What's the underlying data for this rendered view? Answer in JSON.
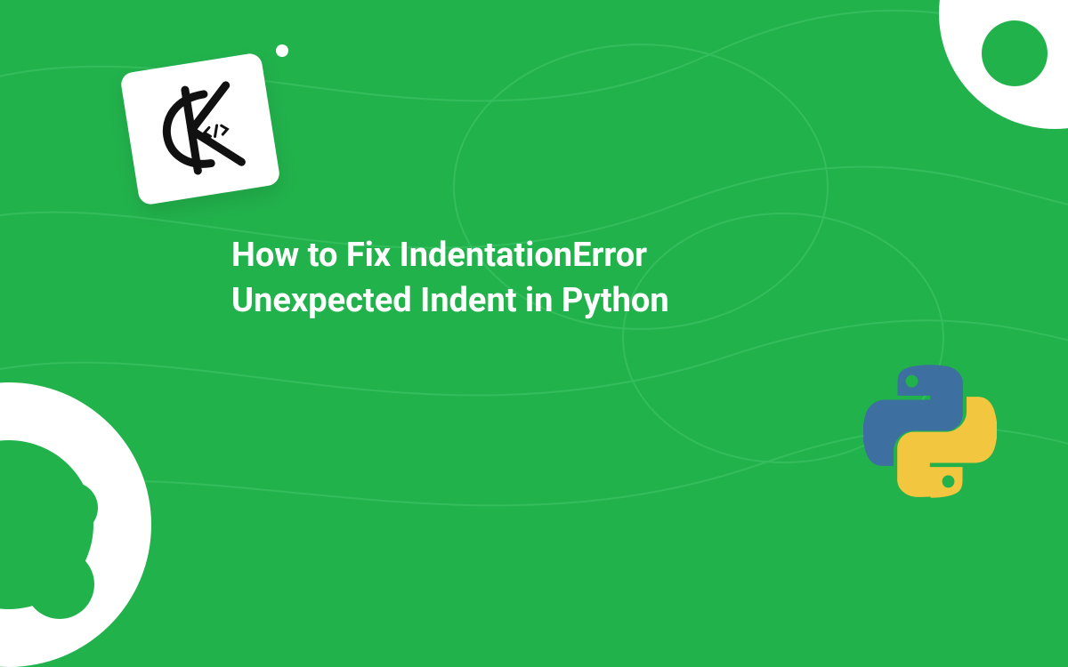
{
  "title_line1": "How to Fix IndentationError",
  "title_line2": "Unexpected Indent in Python",
  "colors": {
    "background": "#22b24c",
    "card": "#ffffff",
    "monogram": "#111111",
    "python_blue": "#3d6fa0",
    "python_yellow": "#f2c63f"
  },
  "icons": {
    "brand_monogram": "k-monogram-icon",
    "language": "python-icon",
    "corner_top_right": "eye-circle-icon",
    "corner_bottom_left": "ring-circle-icon"
  }
}
